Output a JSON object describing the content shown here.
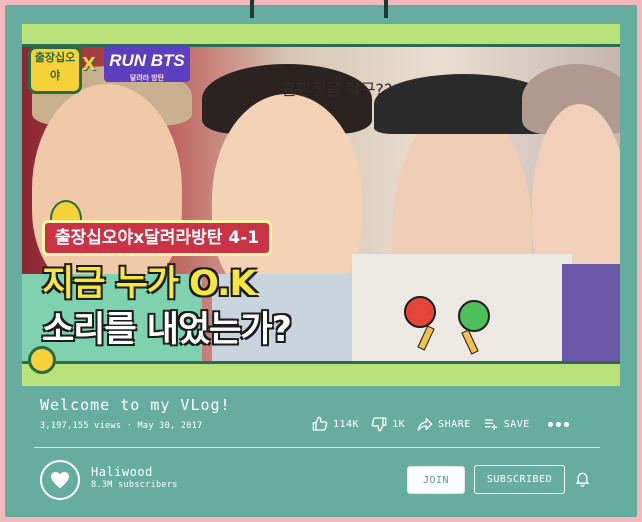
{
  "video": {
    "thumbnail": {
      "badge_text": "출장십오야",
      "x_mark": "X",
      "runbts": "RUN BTS",
      "runbts_sub": "달려라 방탄",
      "caption": "훈민정음 탁구??",
      "episode": "출장십오야x달려라방탄 4-1",
      "title_line1": "지금 누가 O.K",
      "title_line2": "소리를 내었는가?"
    },
    "title": "Welcome to my VLog!",
    "meta": "3,197,155 views · May 30, 2017",
    "actions": {
      "like_count": "114K",
      "dislike_count": "1K",
      "share_label": "SHARE",
      "save_label": "SAVE"
    }
  },
  "channel": {
    "name": "Haliwood",
    "subscribers": "8.3M subscribers",
    "join_label": "JOIN",
    "subscribed_label": "SUBSCRIBED"
  },
  "icons": [
    "thumbs-up-icon",
    "thumbs-down-icon",
    "share-icon",
    "save-playlist-icon",
    "more-icon",
    "heart-icon",
    "bell-icon"
  ],
  "colors": {
    "page_bg": "#f2b8be",
    "card_bg": "#66ad9f",
    "text": "#ffffff"
  }
}
